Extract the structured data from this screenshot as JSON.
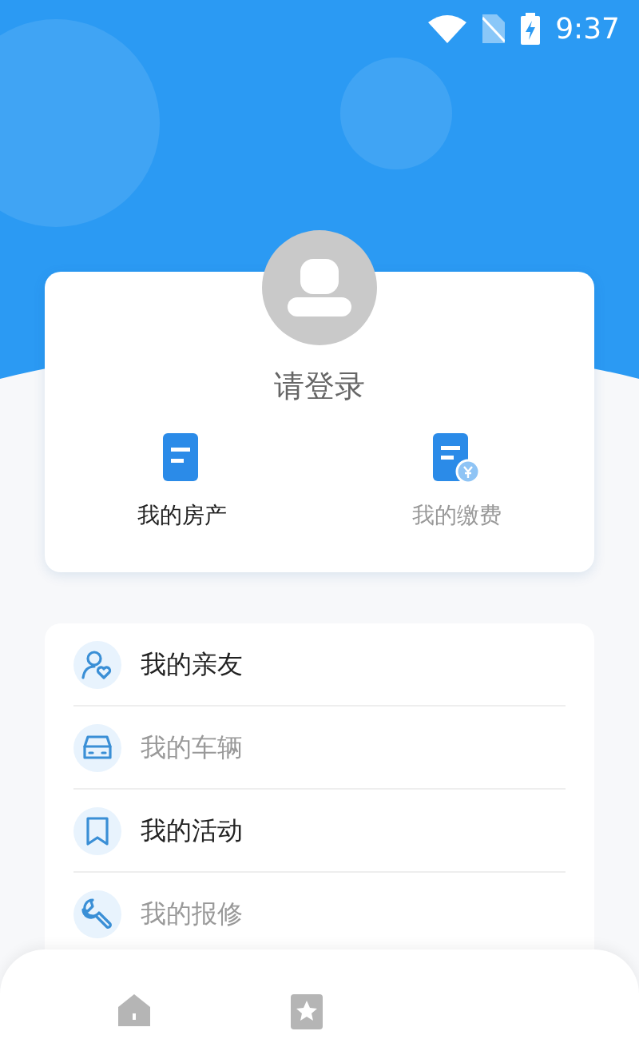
{
  "status_bar": {
    "time": "9:37"
  },
  "profile": {
    "login_prompt": "请登录"
  },
  "shortcuts": [
    {
      "label": "我的房产",
      "disabled": false,
      "kind": "property"
    },
    {
      "label": "我的缴费",
      "disabled": true,
      "kind": "payment"
    }
  ],
  "menu": [
    {
      "label": "我的亲友",
      "disabled": false,
      "kind": "friends"
    },
    {
      "label": "我的车辆",
      "disabled": true,
      "kind": "vehicle"
    },
    {
      "label": "我的活动",
      "disabled": false,
      "kind": "activity"
    },
    {
      "label": "我的报修",
      "disabled": true,
      "kind": "repair"
    }
  ],
  "bottom_nav": [
    {
      "kind": "home"
    },
    {
      "kind": "favorites"
    }
  ]
}
